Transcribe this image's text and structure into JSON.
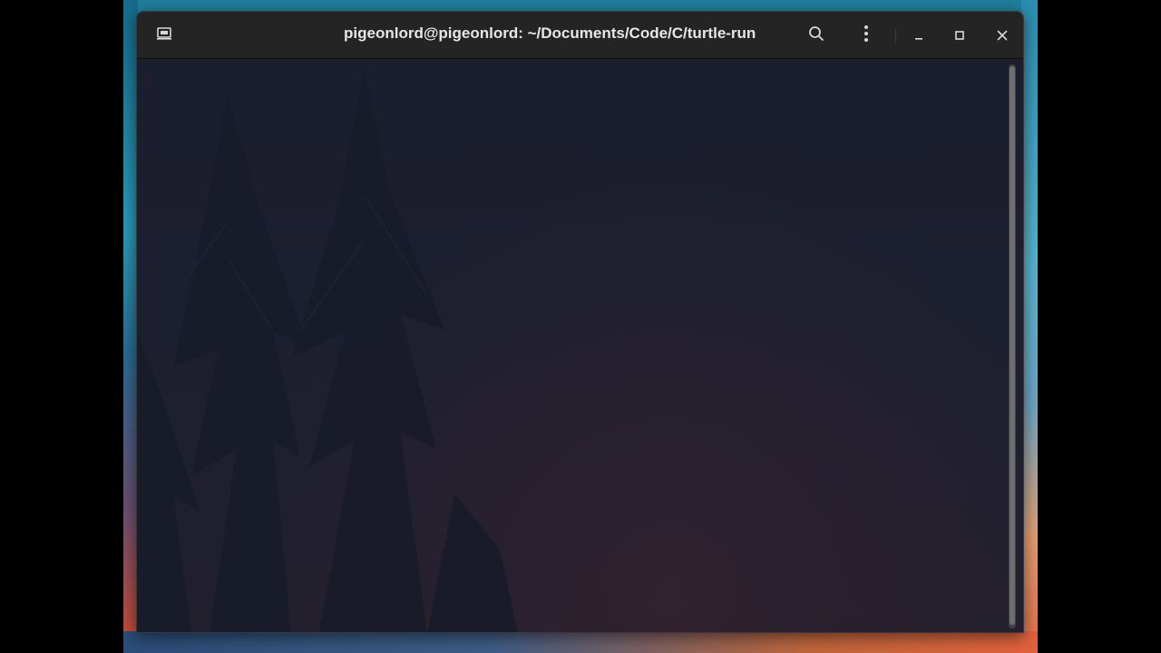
{
  "window": {
    "title": "pigeonlord@pigeonlord: ~/Documents/Code/C/turtle-run"
  },
  "titlebar": {
    "buttons": [
      {
        "name": "new-tab",
        "icon": "terminal-new-tab-icon"
      },
      {
        "name": "search",
        "icon": "search-icon"
      },
      {
        "name": "menu",
        "icon": "kebab-menu-icon"
      },
      {
        "name": "minimize",
        "icon": "minimize-icon"
      },
      {
        "name": "maximize",
        "icon": "maximize-icon"
      },
      {
        "name": "close",
        "icon": "close-icon"
      }
    ]
  },
  "terminal": {
    "output": "",
    "scroll_fraction": 1.0
  },
  "colors": {
    "titlebar": "#242424",
    "terminal_bg": "#1c1f2f",
    "title_text": "#e6e6e6"
  }
}
